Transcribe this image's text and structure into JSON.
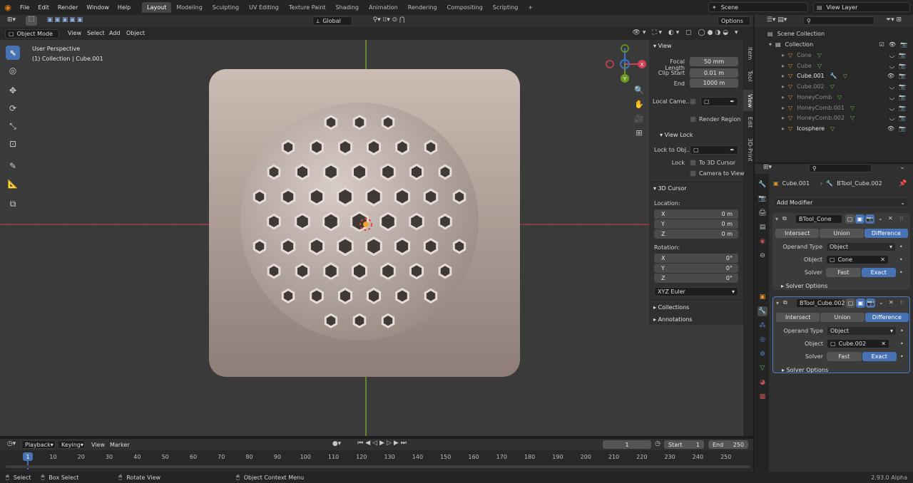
{
  "menus": [
    "File",
    "Edit",
    "Render",
    "Window",
    "Help"
  ],
  "workspaces": [
    "Layout",
    "Modeling",
    "Sculpting",
    "UV Editing",
    "Texture Paint",
    "Shading",
    "Animation",
    "Rendering",
    "Compositing",
    "Scripting"
  ],
  "scene": "Scene",
  "view_layer": "View Layer",
  "viewport": {
    "mode": "Object Mode",
    "menus": [
      "View",
      "Select",
      "Add",
      "Object"
    ],
    "orientation": "Global",
    "options": "Options",
    "info_title": "User Perspective",
    "info_sub": "(1) Collection | Cube.001",
    "gizmo": {
      "x": "X",
      "y": "Y",
      "z": "Z"
    }
  },
  "npanel": {
    "tabs": [
      "Item",
      "Tool",
      "View",
      "Edit",
      "3D-Print"
    ],
    "view_title": "View",
    "focal_label": "Focal Length",
    "focal": "50 mm",
    "clip_start_label": "Clip Start",
    "clip_start": "0.01 m",
    "end_label": "End",
    "end": "1000 m",
    "local_camera": "Local Came...",
    "render_region": "Render Region",
    "view_lock_title": "View Lock",
    "lock_to_obj": "Lock to Obj...",
    "lock_label": "Lock",
    "to_3d_cursor": "To 3D Cursor",
    "camera_to_view": "Camera to View",
    "cursor_title": "3D Cursor",
    "location_label": "Location:",
    "loc": [
      {
        "axis": "X",
        "val": "0 m"
      },
      {
        "axis": "Y",
        "val": "0 m"
      },
      {
        "axis": "Z",
        "val": "0 m"
      }
    ],
    "rotation_label": "Rotation:",
    "rot": [
      {
        "axis": "X",
        "val": "0°"
      },
      {
        "axis": "Y",
        "val": "0°"
      },
      {
        "axis": "Z",
        "val": "0°"
      }
    ],
    "rot_mode": "XYZ Euler",
    "collections": "Collections",
    "annotations": "Annotations"
  },
  "outliner": {
    "root": "Scene Collection",
    "collection": "Collection",
    "items": [
      {
        "name": "Cone",
        "active": false
      },
      {
        "name": "Cube",
        "active": false
      },
      {
        "name": "Cube.001",
        "active": true
      },
      {
        "name": "Cube.002",
        "active": false
      },
      {
        "name": "HoneyComb",
        "active": false
      },
      {
        "name": "HoneyComb.001",
        "active": false
      },
      {
        "name": "HoneyComb.002",
        "active": false
      },
      {
        "name": "Icosphere",
        "active": true
      }
    ]
  },
  "properties": {
    "object": "Cube.001",
    "modifier_breadcrumb": "BTool_Cube.002",
    "add_modifier": "Add Modifier",
    "modifiers": [
      {
        "name": "BTool_Cone",
        "ops": [
          "Intersect",
          "Union",
          "Difference"
        ],
        "operand_type_label": "Operand Type",
        "operand_type": "Object",
        "object_label": "Object",
        "object": "Cone",
        "solver_label": "Solver",
        "solvers": [
          "Fast",
          "Exact"
        ],
        "solver_options": "Solver Options"
      },
      {
        "name": "BTool_Cube.002",
        "ops": [
          "Intersect",
          "Union",
          "Difference"
        ],
        "operand_type_label": "Operand Type",
        "operand_type": "Object",
        "object_label": "Object",
        "object": "Cube.002",
        "solver_label": "Solver",
        "solvers": [
          "Fast",
          "Exact"
        ],
        "solver_options": "Solver Options"
      }
    ]
  },
  "timeline": {
    "menus": [
      "Playback",
      "Keying",
      "View",
      "Marker"
    ],
    "current": "1",
    "start_label": "Start",
    "start": "1",
    "end_label": "End",
    "end": "250",
    "ticks": [
      "1",
      "10",
      "20",
      "30",
      "40",
      "50",
      "60",
      "70",
      "80",
      "90",
      "100",
      "110",
      "120",
      "130",
      "140",
      "150",
      "160",
      "170",
      "180",
      "190",
      "200",
      "210",
      "220",
      "230",
      "240",
      "250"
    ]
  },
  "status": {
    "select": "Select",
    "box_select": "Box Select",
    "rotate": "Rotate View",
    "context": "Object Context Menu",
    "version": "2.93.0 Alpha"
  }
}
